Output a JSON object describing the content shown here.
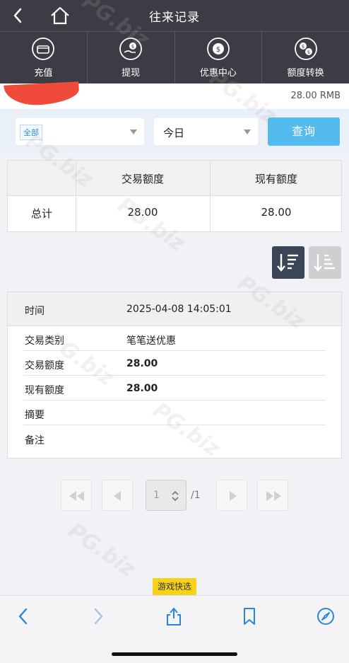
{
  "header": {
    "title": "往来记录"
  },
  "nav": [
    {
      "label": "充值",
      "icon": "deposit-icon"
    },
    {
      "label": "提现",
      "icon": "withdraw-icon"
    },
    {
      "label": "优惠中心",
      "icon": "promo-icon"
    },
    {
      "label": "额度转换",
      "icon": "transfer-icon"
    }
  ],
  "balance": "28.00 RMB",
  "filters": {
    "type_tag": "全部",
    "period": "今日",
    "query_label": "查询"
  },
  "summary": {
    "headers": [
      "交易额度",
      "现有额度"
    ],
    "row_label": "总计",
    "values": [
      "28.00",
      "28.00"
    ]
  },
  "record": {
    "time_label": "时间",
    "time_value": "2025-04-08 14:05:01",
    "fields": [
      {
        "label": "交易类别",
        "value": "笔笔送优惠"
      },
      {
        "label": "交易额度",
        "value": "28.00"
      },
      {
        "label": "现有额度",
        "value": "28.00"
      },
      {
        "label": "摘要",
        "value": ""
      },
      {
        "label": "备注",
        "value": ""
      }
    ]
  },
  "pager": {
    "current": "1",
    "total": "/1"
  },
  "game_quick_pick": "游戏快选",
  "watermark": "PG.biz",
  "colors": {
    "topbar": "#3c3d44",
    "query": "#53bbee",
    "badge": "#f7d21a",
    "browser_accent": "#2a86d9"
  }
}
